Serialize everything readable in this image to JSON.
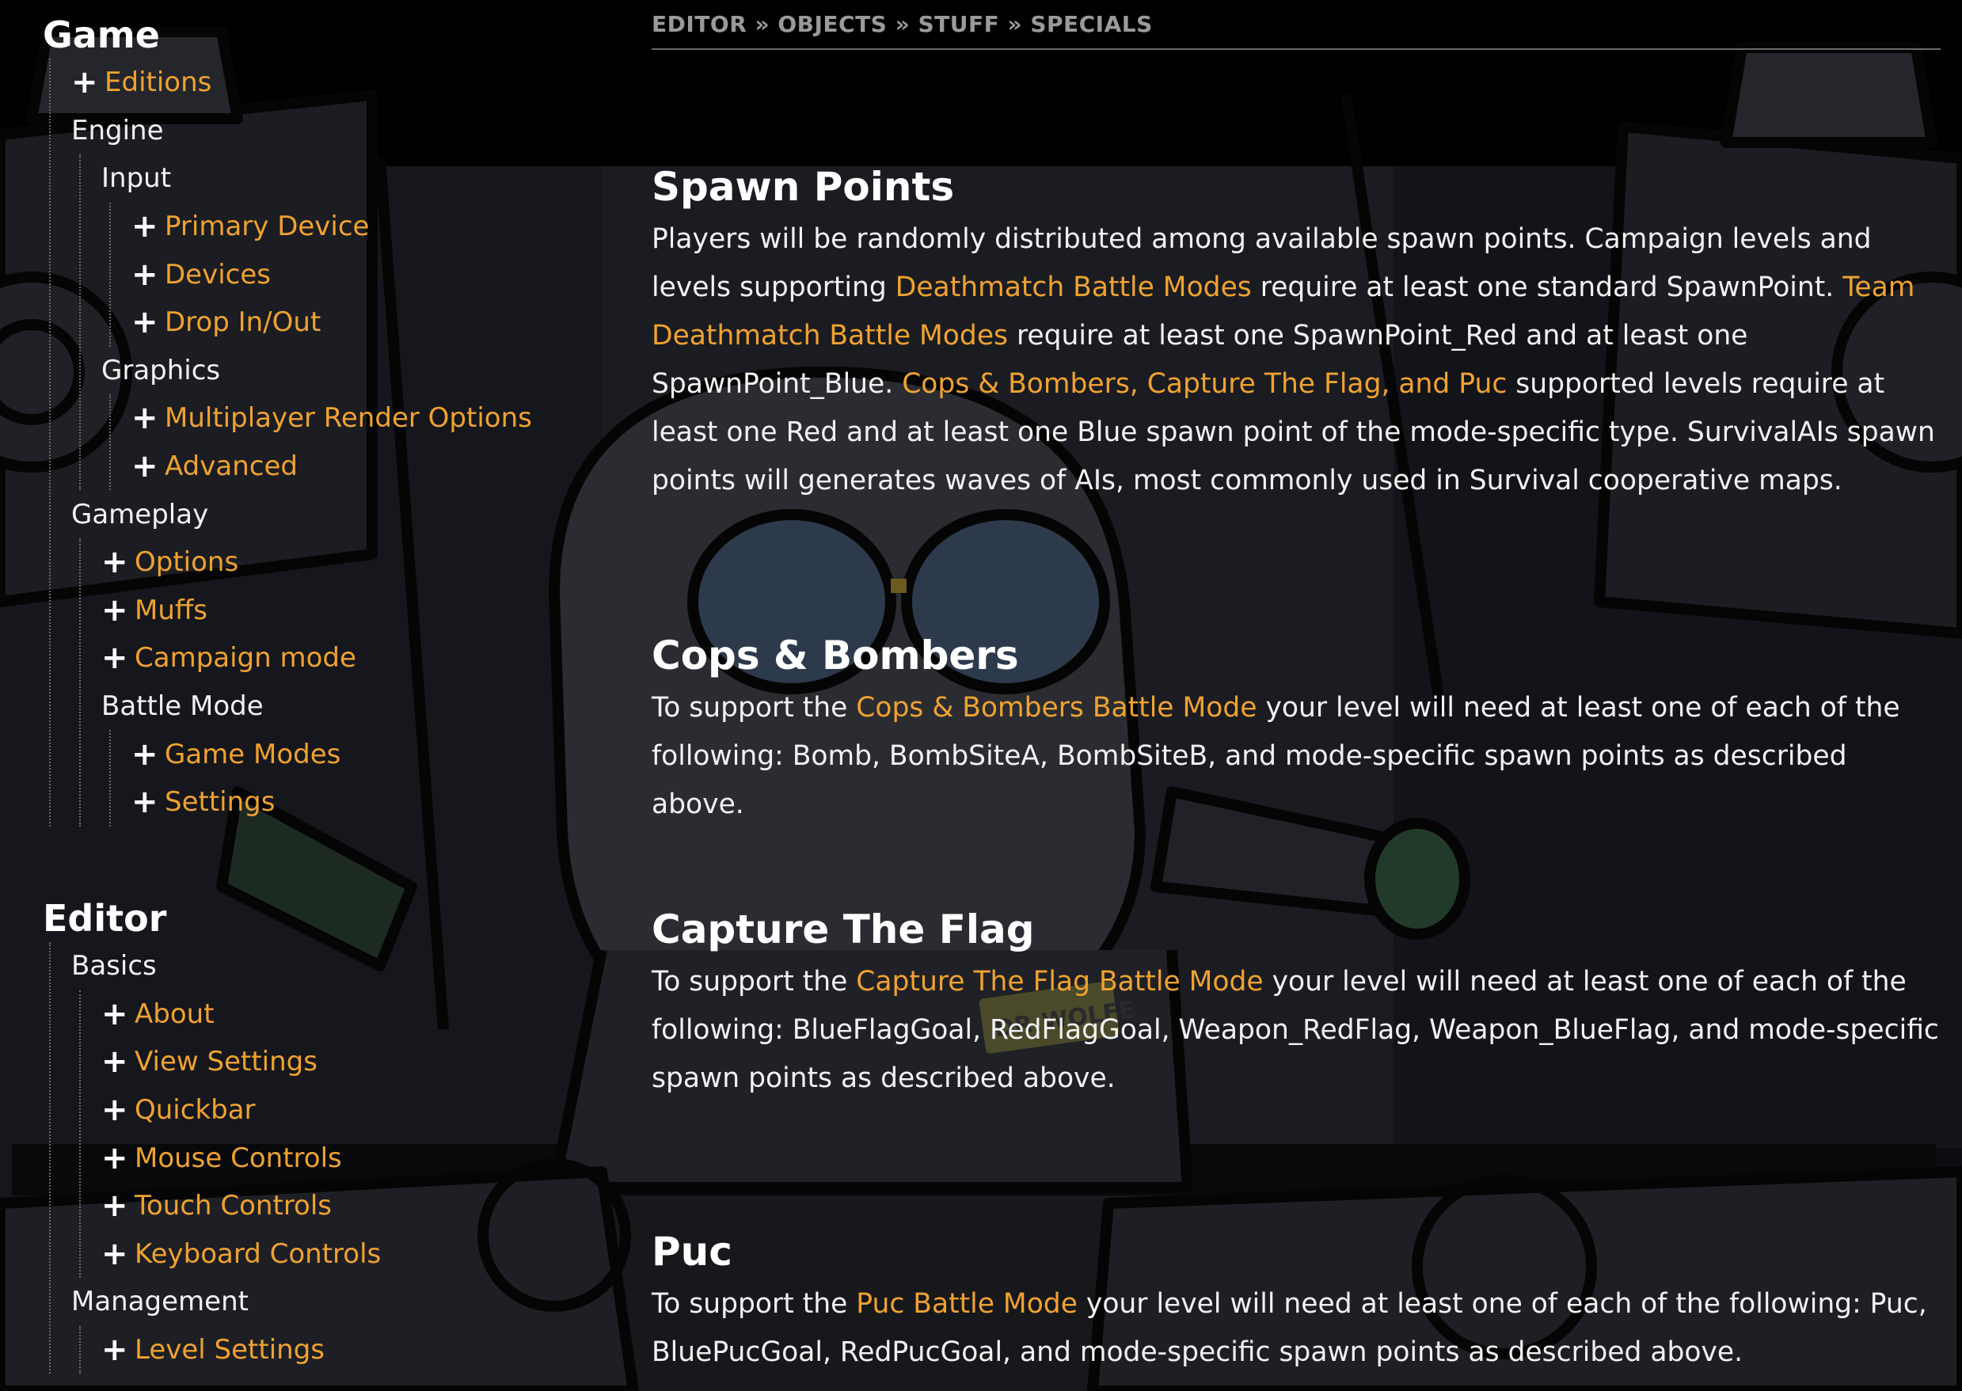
{
  "breadcrumb": {
    "editor": "EDITOR",
    "sep": "»",
    "objects": "OBJECTS",
    "stuff": "STUFF",
    "specials": "SPECIALS"
  },
  "sidebar": {
    "game": {
      "title": "Game",
      "editions": "Editions",
      "engine": "Engine",
      "input": "Input",
      "primary_device": "Primary Device",
      "devices": "Devices",
      "drop_in_out": "Drop In/Out",
      "graphics": "Graphics",
      "multiplayer_render_options": "Multiplayer Render Options",
      "advanced": "Advanced",
      "gameplay": "Gameplay",
      "options": "Options",
      "muffs": "Muffs",
      "campaign_mode": "Campaign mode",
      "battle_mode": "Battle Mode",
      "game_modes": "Game Modes",
      "settings": "Settings"
    },
    "editor": {
      "title": "Editor",
      "basics": "Basics",
      "about": "About",
      "view_settings": "View Settings",
      "quickbar": "Quickbar",
      "mouse_controls": "Mouse Controls",
      "touch_controls": "Touch Controls",
      "keyboard_controls": "Keyboard Controls",
      "management": "Management",
      "level_settings": "Level Settings"
    }
  },
  "sections": {
    "spawn": {
      "title": "Spawn Points",
      "t1": "Players will be randomly distributed among available spawn points. Campaign levels and levels supporting ",
      "l1": "Deathmatch Battle Modes",
      "t2": " require at least one standard SpawnPoint. ",
      "l2": "Team Deathmatch Battle Modes",
      "t3": " require at least one SpawnPoint_Red and at least one SpawnPoint_Blue. ",
      "l3": "Cops & Bombers, Capture The Flag, and Puc",
      "t4": " supported levels require at least one Red and at least one Blue spawn point of the mode-specific type. SurvivalAIs spawn points will generates waves of AIs, most commonly used in Survival cooperative maps."
    },
    "cops": {
      "title": "Cops & Bombers",
      "t1": "To support the ",
      "l1": "Cops & Bombers Battle Mode",
      "t2": " your level will need at least one of each of the following: Bomb, BombSiteA, BombSiteB, and mode-specific spawn points as described above."
    },
    "ctf": {
      "title": "Capture The Flag",
      "t1": "To support the ",
      "l1": "Capture The Flag Battle Mode",
      "t2": " your level will need at least one of each of the following: BlueFlagGoal, RedFlagGoal, Weapon_RedFlag, Weapon_BlueFlag, and mode-specific spawn points as described above."
    },
    "puc": {
      "title": "Puc",
      "t1": "To support the ",
      "l1": "Puc Battle Mode",
      "t2": " your level will need at least one of each of the following: Puc, BluePucGoal, RedPucGoal, and mode-specific spawn points as described above."
    }
  },
  "background_art": {
    "watermark": "DR.WOLFE"
  },
  "colors": {
    "link": "#f0a22e",
    "text": "#f2f2f2",
    "heading": "#ffffff",
    "breadcrumb": "#9a9a9a"
  },
  "icons": {
    "expand": "plus-icon"
  }
}
